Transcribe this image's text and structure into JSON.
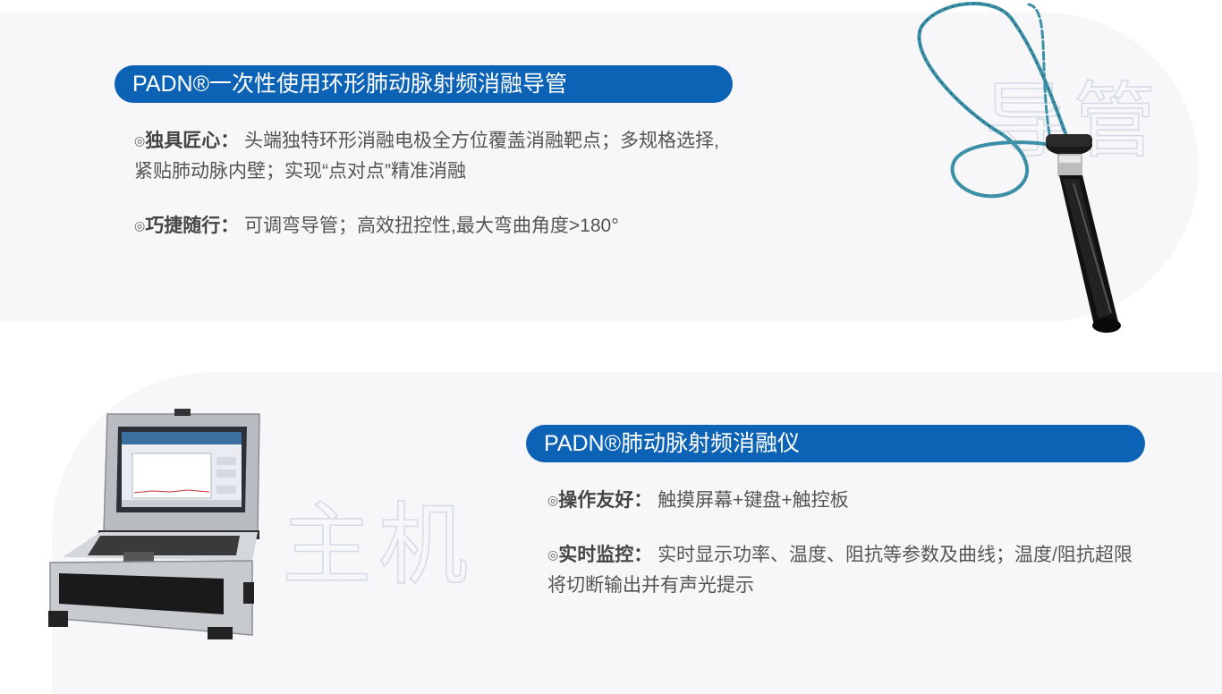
{
  "sections": {
    "catheter": {
      "title": "PADN®一次性使用环形肺动脉射频消融导管",
      "watermark": "导管",
      "image_label": "catheter-product-image",
      "features": [
        {
          "bullet": "◎",
          "name": "独具匠心：",
          "desc": "头端独特环形消融电极全方位覆盖消融靶点；多规格选择,紧贴肺动脉内壁；实现“点对点”精准消融"
        },
        {
          "bullet": "◎",
          "name": "巧捷随行：",
          "desc": "可调弯导管；高效扭控性,最大弯曲角度>180°"
        }
      ]
    },
    "host": {
      "title": "PADN®肺动脉射频消融仪",
      "watermark": "主机",
      "image_label": "ablation-host-device-image",
      "features": [
        {
          "bullet": "◎",
          "name": "操作友好：",
          "desc": "触摸屏幕+键盘+触控板"
        },
        {
          "bullet": "◎",
          "name": "实时监控：",
          "desc": "实时显示功率、温度、阻抗等参数及曲线；温度/阻抗超限将切断输出并有声光提示"
        }
      ]
    }
  },
  "colors": {
    "accent": "#0c63b6",
    "panel": "#f7f7f9",
    "catheter_tube": "#3b8fa6"
  }
}
